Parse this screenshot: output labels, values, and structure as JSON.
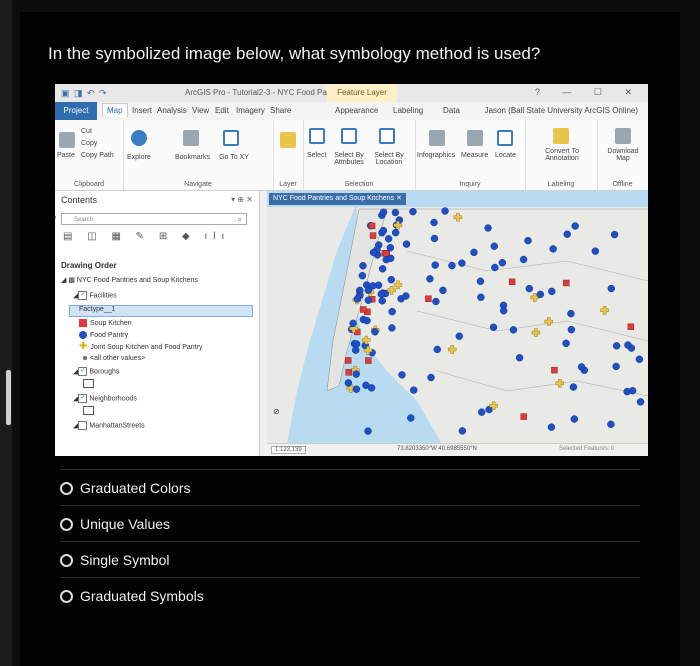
{
  "question": "In the symbolized image below, what symbology method is used?",
  "app": {
    "title": "ArcGIS Pro - Tutorial2-3 - NYC Food Pantrie...",
    "context_tab": "Feature Layer",
    "tabs": [
      "Project",
      "Map",
      "Insert",
      "Analysis",
      "View",
      "Edit",
      "Imagery",
      "Share",
      "Appearance",
      "Labeling",
      "Data"
    ],
    "user": "Jason (Ball State University ArcGIS Online)",
    "ribbon": {
      "clipboard": {
        "cut": "Cut",
        "copy": "Copy",
        "copy_path": "Copy Path",
        "paste": "Paste",
        "label": "Clipboard"
      },
      "navigate": {
        "explore": "Explore",
        "bookmarks": "Bookmarks",
        "go_to_xy": "Go To XY",
        "label": "Navigate"
      },
      "layer": {
        "label": "Layer"
      },
      "selection": {
        "select": "Select",
        "select_by_attributes": "Select By Attributes",
        "select_by_location": "Select By Location",
        "label": "Selection"
      },
      "inquiry": {
        "infographics": "Infographics",
        "measure": "Measure",
        "locate": "Locate",
        "label": "Inquiry"
      },
      "labeling": {
        "convert_to_annotation": "Convert To Annotation",
        "label": "Labeling"
      },
      "offline": {
        "download_map": "Download Map",
        "label": "Offline"
      }
    },
    "contents": {
      "title": "Contents",
      "search_placeholder": "Search",
      "drawing_order": "Drawing Order",
      "map_name": "NYC Food Pantries and Soup Kitchens",
      "layer_facilities": "Facilities",
      "field": "Factype__1",
      "legend": [
        {
          "label": "Soup Kitchen",
          "color": "#e03a3a",
          "shape": "square"
        },
        {
          "label": "Food Pantry",
          "color": "#1e4fc7",
          "shape": "circle"
        },
        {
          "label": "Joint Soup Kitchen and Food Pantry",
          "color": "#e8c44a",
          "shape": "plus"
        },
        {
          "label": "<all other values>",
          "color": "#6a6a6a",
          "shape": "dot"
        }
      ],
      "layer_boroughs": "Boroughs",
      "layer_neighborhoods": "Neighborhoods",
      "layer_streets": "ManhattanStreets"
    },
    "map": {
      "tab_title": "NYC Food Pantries and Soup Kitchens",
      "scale": "1:123,139",
      "coordinates": "73.8203350°W 40.6985550°N",
      "selected": "Selected Features: 0",
      "colors": {
        "water": "#b9dbf2",
        "land": "#e9e9e6",
        "soup": "#e03a3a",
        "pantry": "#1e4fc7",
        "joint": "#e8c44a"
      }
    }
  },
  "options": [
    {
      "label": "Graduated Colors"
    },
    {
      "label": "Unique Values"
    },
    {
      "label": "Single Symbol"
    },
    {
      "label": "Graduated Symbols"
    }
  ]
}
